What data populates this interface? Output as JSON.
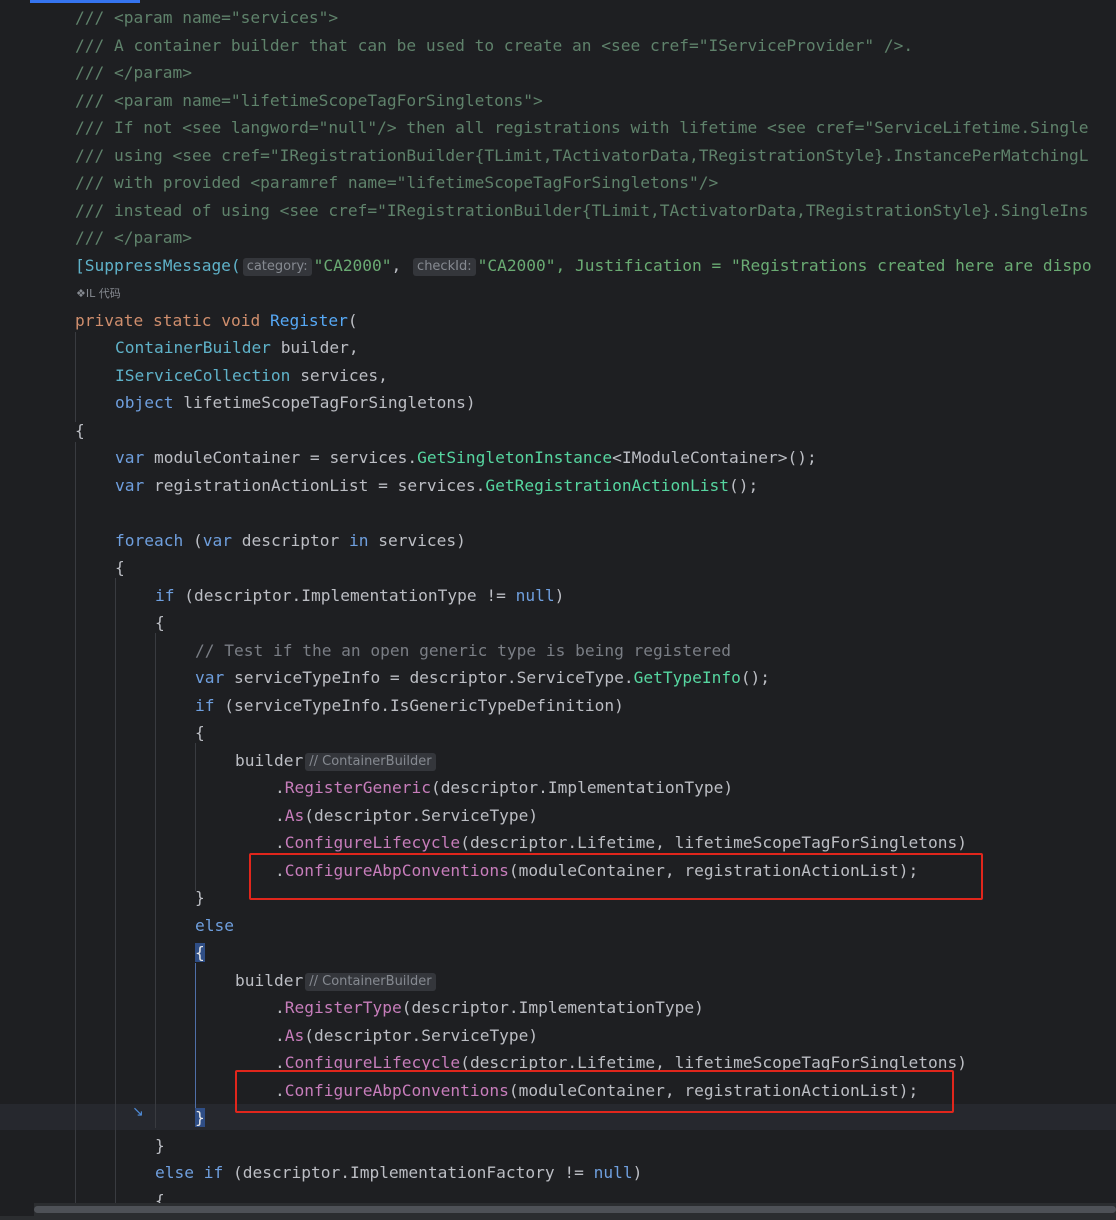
{
  "editor": {
    "lines": [
      "/// <param name=\"services\">",
      "/// A container builder that can be used to create an <see cref=\"IServiceProvider\" />.",
      "/// </param>",
      "/// <param name=\"lifetimeScopeTagForSingletons\">",
      "/// If not <see langword=\"null\"/> then all registrations with lifetime <see cref=\"ServiceLifetime.Single",
      "/// using <see cref=\"IRegistrationBuilder{TLimit,TActivatorData,TRegistrationStyle}.InstancePerMatchingL",
      "/// with provided <paramref name=\"lifetimeScopeTagForSingletons\"/>",
      "/// instead of using <see cref=\"IRegistrationBuilder{TLimit,TActivatorData,TRegistrationStyle}.SingleIns",
      "/// </param>"
    ],
    "suppress": {
      "open": "[SuppressMessage(",
      "hint_category": "category:",
      "arg1": "\"CA2000\"",
      "sep1": ", ",
      "hint_checkid": "checkId:",
      "arg2": "\"CA2000\"",
      "rest": ", Justification = \"Registrations created here are dispo"
    },
    "il_marker": "❖IL 代码",
    "sig": {
      "private": "private",
      "static": "static",
      "void": "void",
      "name": "Register",
      "p1_type": "ContainerBuilder",
      "p1_name": "builder,",
      "p2_type": "IServiceCollection",
      "p2_name": "services,",
      "p3_type": "object",
      "p3_name": "lifetimeScopeTagForSingletons)"
    },
    "body": {
      "open_brace": "{",
      "var": "var",
      "l1_name": "moduleContainer",
      "l1_eq": " = ",
      "l1_obj": "services",
      "l1_method": "GetSingletonInstance",
      "l1_generic": "<IModuleContainer>",
      "l1_end": "();",
      "l2_name": "registrationActionList",
      "l2_method": "GetRegistrationActionList",
      "l2_end": "();",
      "foreach": "foreach",
      "in": "in",
      "descriptor": "descriptor",
      "services_close": "services)",
      "if": "if",
      "impl_type": "ImplementationType",
      "neq": " != ",
      "null": "null",
      "comment": "// Test if the an open generic type is being registered",
      "sti": "serviceTypeInfo",
      "service_type": "ServiceType",
      "get_type_info": "GetTypeInfo",
      "is_generic": "IsGenericTypeDefinition",
      "builder": "builder",
      "hint_builder": "// ContainerBuilder",
      "register_generic": "RegisterGeneric",
      "register_type": "RegisterType",
      "as": "As",
      "configure_lifecycle": "ConfigureLifecycle",
      "lifetime": "Lifetime",
      "lstfs": "lifetimeScopeTagForSingletons",
      "configure_abp": "ConfigureAbpConventions",
      "module_container": "moduleContainer",
      "ral": "registrationActionList",
      "else": "else",
      "else_if": "else if",
      "impl_factory": "ImplementationFactory",
      "close_brace": "}"
    }
  },
  "colors": {
    "background": "#1e1f22",
    "highlight_box": "#e1261c",
    "accent": "#3574f0"
  }
}
